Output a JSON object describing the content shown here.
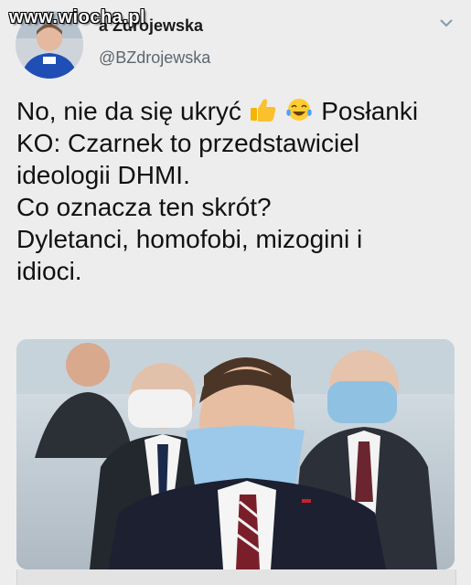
{
  "watermark": "www.wiocha.pl",
  "user": {
    "display_name": "Barbara Zdrojewska",
    "display_name_visible": "a Zdrojewska",
    "handle": "@BZdrojewska"
  },
  "tweet": {
    "lines": [
      "No, nie da się ukryć",
      "Posłanki",
      "KO: Czarnek to przedstawiciel",
      "ideologii DHMI.",
      "Co oznacza ten skrót?",
      "Dyletanci, homofobi, mizogini i",
      "idioci."
    ],
    "emojis": [
      "thumbs-up",
      "tears-of-joy"
    ]
  },
  "icons": {
    "menu": "chevron-down-icon"
  },
  "colors": {
    "background": "#ededed",
    "text": "#111111",
    "handle": "#5b6670"
  }
}
